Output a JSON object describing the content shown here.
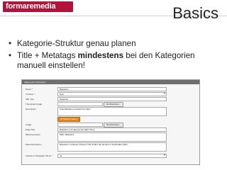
{
  "header": {
    "logo_text": "formaremedia",
    "slide_title": "Basics"
  },
  "bullets": [
    {
      "text": "Kategorie-Struktur genau planen"
    },
    {
      "pre": "Title + Metatags ",
      "strong": "mindestens",
      "post": " bei den Kategorien manuell einstellen!"
    }
  ],
  "form": {
    "header": "Allgemeine Information",
    "fields": {
      "name": {
        "label": "Name *",
        "value": "Basteltee"
      },
      "is_active": {
        "label": "Is Active *",
        "value": "Nein"
      },
      "url_key": {
        "label": "URL Key",
        "value": "basteltee"
      },
      "thumbnail": {
        "label": "Thumbnail Image",
        "button": "Durchsuchen..."
      },
      "description": {
        "label": "Description",
        "value": "Tolle Basteltee Auswahl bei SEO"
      },
      "wysiwyg": {
        "label": "",
        "button": "WYSIWYG Editor"
      },
      "image": {
        "label": "Image",
        "button": "Durchsuchen..."
      },
      "page_title": {
        "label": "Page Title",
        "value": "Basteltee mit Lidgruss bei SEO Shop"
      },
      "meta_keywords": {
        "label": "Meta Keywords",
        "value": "SEO, Basteltee"
      },
      "meta_description": {
        "label": "Meta Description",
        "value": "Basteltee zu kleinen Preisen? Die finden Sie bei Ihrem Teeshadtier SEO"
      },
      "include_nav": {
        "label": "Include in Navigation Menu *",
        "value": "Ja"
      }
    }
  }
}
